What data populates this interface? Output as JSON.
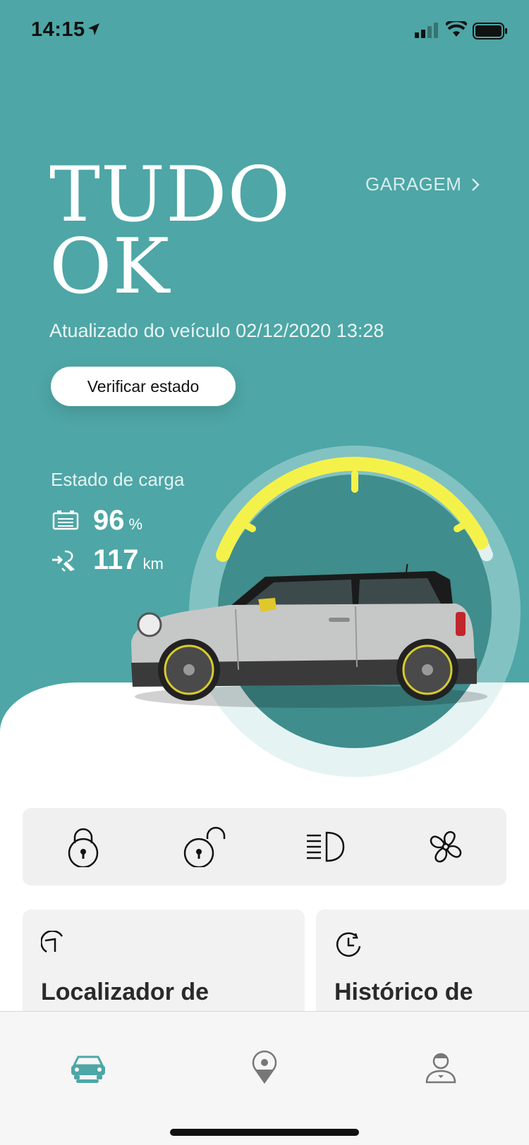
{
  "status_bar": {
    "time": "14:15",
    "icons": [
      "location-arrow-icon",
      "cellular-signal-icon",
      "wifi-icon",
      "battery-icon"
    ]
  },
  "header": {
    "title_line1": "TUDO",
    "title_line2": "OK",
    "garage_label": "GARAGEM",
    "updated_text": "Atualizado do veículo 02/12/2020 13:28",
    "verify_button": "Verificar estado"
  },
  "charge": {
    "label": "Estado de carga",
    "battery_value": "96",
    "battery_unit": "%",
    "battery_fraction": 0.96,
    "range_value": "117",
    "range_unit": "km"
  },
  "quick_actions": [
    {
      "name": "lock-icon"
    },
    {
      "name": "unlock-icon"
    },
    {
      "name": "headlight-icon"
    },
    {
      "name": "fan-icon"
    }
  ],
  "cards": [
    {
      "title": "Localizador de",
      "icon": "locator-arrow-icon"
    },
    {
      "title": "Histórico de",
      "icon": "clock-history-icon"
    }
  ],
  "tab_bar": {
    "tabs": [
      {
        "name": "vehicle-tab",
        "icon": "car-icon",
        "active": true
      },
      {
        "name": "map-tab",
        "icon": "map-pin-icon",
        "active": false
      },
      {
        "name": "profile-tab",
        "icon": "concierge-icon",
        "active": false
      }
    ]
  },
  "colors": {
    "hero_teal": "#4ea6a6",
    "gauge_yellow": "#f4f24a",
    "gauge_inner": "#3f8d8c",
    "gauge_outer_ring": "#c5e4e4"
  }
}
